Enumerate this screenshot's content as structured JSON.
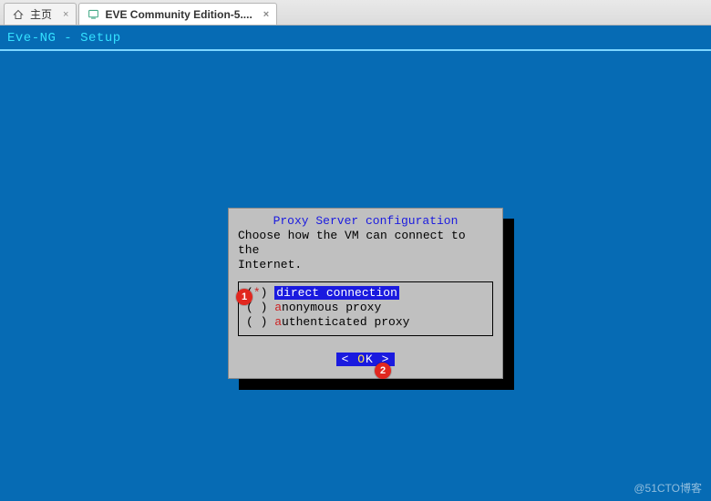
{
  "tabs": {
    "home": "主页",
    "active": "EVE Community Edition-5....",
    "close_glyph": "×"
  },
  "terminal": {
    "title": "Eve-NG - Setup"
  },
  "dialog": {
    "title": "Proxy Server configuration",
    "prompt_line1": "Choose how the VM can connect to the",
    "prompt_line2": "Internet.",
    "options": [
      {
        "mark": "(*)",
        "hot": "d",
        "rest": "irect connection",
        "selected": true
      },
      {
        "mark": "( )",
        "hot": "a",
        "rest": "nonymous proxy",
        "selected": false
      },
      {
        "mark": "( )",
        "hot": "a",
        "rest": "uthenticated proxy",
        "selected": false
      }
    ],
    "ok": {
      "left": "<  ",
      "hot": "O",
      "rest": "K  >"
    }
  },
  "annotations": {
    "one": "1",
    "two": "2"
  },
  "watermark": "@51CTO博客"
}
